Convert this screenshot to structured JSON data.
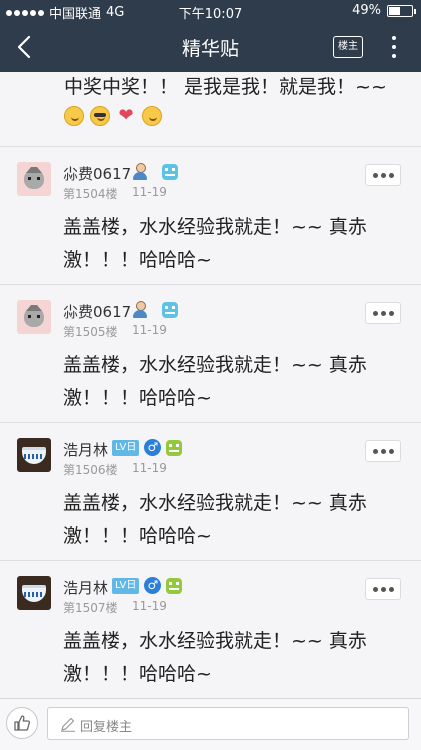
{
  "status": {
    "carrier": "中国联通",
    "network": "4G",
    "time": "下午10:07",
    "battery": "49%",
    "battery_level": 0.49
  },
  "header": {
    "title": "精华贴",
    "owner_label": "楼主"
  },
  "partial_post": {
    "text": "中奖中奖！！ 是我是我！就是我！~~"
  },
  "posts": [
    {
      "username": "尛费0617",
      "floor": "第1504楼",
      "date": "11-19",
      "content": "盖盖楼，水水经验我就走！~~ 真赤激！！！哈哈哈~"
    },
    {
      "username": "尛费0617",
      "floor": "第1505楼",
      "date": "11-19",
      "content": "盖盖楼，水水经验我就走！~~ 真赤激！！！哈哈哈~"
    },
    {
      "username": "浩月林",
      "lv_label": "LV日",
      "gender": "♂",
      "floor": "第1506楼",
      "date": "11-19",
      "content": "盖盖楼，水水经验我就走！~~ 真赤激！！！哈哈哈~"
    },
    {
      "username": "浩月林",
      "lv_label": "LV日",
      "gender": "♂",
      "floor": "第1507楼",
      "date": "11-19",
      "content": "盖盖楼，水水经验我就走！~~ 真赤激！！！哈哈哈~"
    }
  ],
  "bottom": {
    "reply_placeholder": "回复楼主"
  },
  "colors": {
    "header_bg": "#2f3c4b",
    "page_bg": "#f5f5f7",
    "lv_badge": "#5fb8e6",
    "male_badge": "#2b7fd8"
  }
}
